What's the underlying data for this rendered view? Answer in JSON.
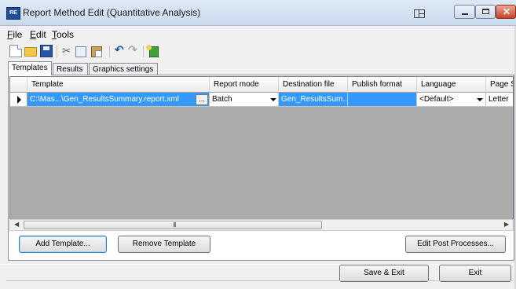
{
  "window": {
    "title": "Report Method Edit (Quantitative Analysis)",
    "icon_name": "report-method-app-icon",
    "buttons": [
      "minimize-icon",
      "maximize-icon",
      "close-icon"
    ]
  },
  "menu": [
    {
      "label": "File",
      "underline": "F"
    },
    {
      "label": "Edit",
      "underline": "E"
    },
    {
      "label": "Tools",
      "underline": "T"
    }
  ],
  "toolbar": {
    "icons": [
      "new-document-icon",
      "open-folder-icon",
      "save-icon",
      "cut-icon",
      "copy-icon",
      "paste-icon",
      "undo-icon",
      "redo-icon",
      "add-item-icon"
    ]
  },
  "tabs": [
    {
      "label": "Templates",
      "active": true
    },
    {
      "label": "Results",
      "active": false
    },
    {
      "label": "Graphics settings",
      "active": false
    }
  ],
  "grid": {
    "columns": [
      "Template",
      "Report mode",
      "Destination file",
      "Publish format",
      "Language",
      "Page S"
    ],
    "rows": [
      {
        "template": "C:\\Mas...\\Gen_ResultsSummary.report.xml",
        "ellipsis": "...",
        "report_mode": "Batch",
        "destination_file": "Gen_ResultsSum...",
        "publish_format": "",
        "language": "<Default>",
        "page_size": "Letter"
      }
    ],
    "scrollbar_grip": "III"
  },
  "buttons": {
    "add_template": "Add Template...",
    "remove_template": "Remove Template",
    "edit_post_processes": "Edit Post Processes...",
    "save_exit": "Save & Exit",
    "exit": "Exit"
  },
  "colors": {
    "selection": "#3399ff",
    "grid_background": "#ababab",
    "window_background": "#f0f0f0"
  }
}
